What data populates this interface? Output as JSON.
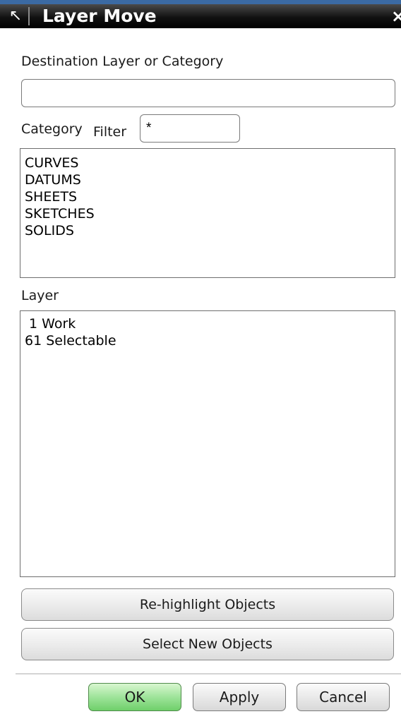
{
  "window": {
    "title": "Layer Move",
    "close_glyph": "×",
    "pin_glyph": "↖"
  },
  "destination": {
    "label": "Destination Layer or Category",
    "value": ""
  },
  "category_filter": {
    "label_category": "Category",
    "label_filter": "Filter",
    "value": "*"
  },
  "categories": {
    "items": [
      "CURVES",
      "DATUMS",
      "SHEETS",
      "SKETCHES",
      "SOLIDS"
    ]
  },
  "layer": {
    "label": "Layer",
    "items": [
      " 1 Work",
      "61 Selectable"
    ]
  },
  "actions": {
    "rehighlight": "Re-highlight Objects",
    "select_new": "Select New Objects"
  },
  "footer": {
    "ok": "OK",
    "apply": "Apply",
    "cancel": "Cancel"
  }
}
